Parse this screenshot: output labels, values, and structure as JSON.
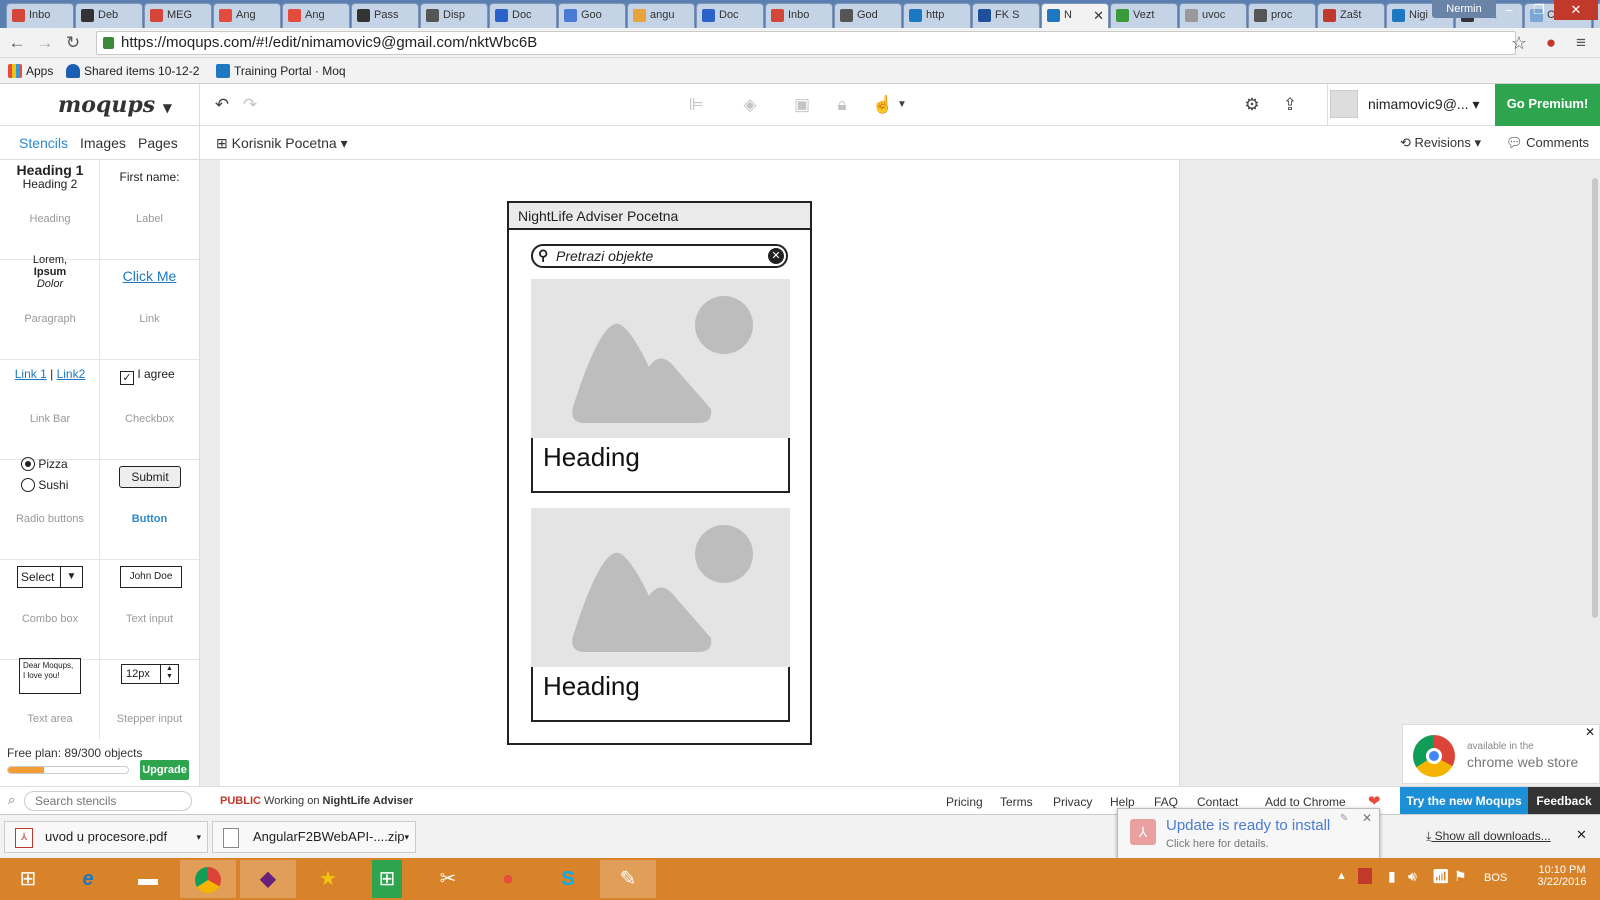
{
  "browser": {
    "tabs": [
      {
        "label": "Inbo",
        "color": "#d44638"
      },
      {
        "label": "Deb",
        "color": "#333333"
      },
      {
        "label": "MEG",
        "color": "#d44638"
      },
      {
        "label": "Ang",
        "color": "#e34c3c"
      },
      {
        "label": "Ang",
        "color": "#e34c3c"
      },
      {
        "label": "Pass",
        "color": "#333333"
      },
      {
        "label": "Disp",
        "color": "#555555"
      },
      {
        "label": "Doc",
        "color": "#2a62c9"
      },
      {
        "label": "Goo",
        "color": "#4a7bd4"
      },
      {
        "label": "angu",
        "color": "#e8a33c"
      },
      {
        "label": "Doc",
        "color": "#2a62c9"
      },
      {
        "label": "Inbo",
        "color": "#d44638"
      },
      {
        "label": "God",
        "color": "#555555"
      },
      {
        "label": "http",
        "color": "#1d78c1"
      },
      {
        "label": "FK S",
        "color": "#1d4f9a"
      },
      {
        "label": "N",
        "color": "#1d78c1",
        "active": true
      },
      {
        "label": "Vezt",
        "color": "#3a9a3a"
      },
      {
        "label": "uvoc",
        "color": "#999999"
      },
      {
        "label": "proc",
        "color": "#555555"
      },
      {
        "label": "Zašt",
        "color": "#c0392b"
      },
      {
        "label": "Nigi",
        "color": "#1d78c1"
      },
      {
        "label": "ooa",
        "color": "#333333"
      },
      {
        "label": "C# I",
        "color": "#7aa7d4"
      }
    ],
    "window_user": "Nermin",
    "url": "https://moqups.com/#!/edit/nimamovic9@gmail.com/nktWbc6B",
    "bookmarks": [
      {
        "label": "Apps"
      },
      {
        "label": "Shared items 10-12-2"
      },
      {
        "label": "Training Portal · Moq"
      }
    ]
  },
  "app": {
    "logo": "moqups",
    "user_label": "nimamovic9@...",
    "premium_label": "Go Premium!",
    "left_tabs": [
      "Stencils",
      "Images",
      "Pages"
    ],
    "page_selector": "Korisnik Pocetna",
    "revisions_label": "Revisions",
    "comments_label": "Comments"
  },
  "stencils": {
    "heading1": "Heading 1",
    "heading2": "Heading 2",
    "heading_cap": "Heading",
    "label_text": "First name:",
    "label_cap": "Label",
    "para_l1": "Lorem,",
    "para_l2": "Ipsum",
    "para_l3": "Dolor",
    "para_cap": "Paragraph",
    "link_text": "Click Me",
    "link_cap": "Link",
    "linkbar_1": "Link 1",
    "linkbar_sep": "|",
    "linkbar_2": "Link2",
    "linkbar_cap": "Link Bar",
    "checkbox_text": "I agree",
    "checkbox_cap": "Checkbox",
    "radio_1": "Pizza",
    "radio_2": "Sushi",
    "radio_cap": "Radio buttons",
    "button_text": "Submit",
    "button_cap": "Button",
    "combo_text": "Select",
    "combo_cap": "Combo box",
    "textinput_text": "John Doe",
    "textinput_cap": "Text input",
    "textarea_text": "Dear Moqups, I love you!",
    "textarea_cap": "Text area",
    "stepper_text": "12px",
    "stepper_cap": "Stepper input"
  },
  "plan": {
    "label": "Free plan: 89/300 objects",
    "used": 89,
    "total": 300,
    "upgrade_label": "Upgrade"
  },
  "search_stencils_placeholder": "Search stencils",
  "mockup": {
    "title": "NightLife Adviser Pocetna",
    "search_placeholder": "Pretrazi objekte",
    "cards": [
      {
        "heading": "Heading"
      },
      {
        "heading": "Heading"
      }
    ]
  },
  "footer": {
    "public_label": "PUBLIC",
    "working_prefix": "Working on",
    "project_name": "NightLife Adviser",
    "links": [
      "Pricing",
      "Terms",
      "Privacy",
      "Help",
      "FAQ",
      "Contact",
      "Add to Chrome"
    ],
    "try_new": "Try the new Moqups",
    "feedback": "Feedback"
  },
  "chrome_store": {
    "line1": "available in the",
    "line2": "chrome web store"
  },
  "downloads": {
    "items": [
      "uvod u procesore.pdf",
      "AngularF2BWebAPI-....zip"
    ],
    "show_all": "Show all downloads..."
  },
  "notification": {
    "title": "Update is ready to install",
    "subtitle": "Click here for details."
  },
  "taskbar": {
    "lang": "BOS",
    "time": "10:10 PM",
    "date": "3/22/2016"
  },
  "colors": {
    "accent_blue": "#2a8bd0",
    "premium_green": "#2ea44f",
    "taskbar": "#d8832a",
    "plan_orange": "#f39c33"
  }
}
